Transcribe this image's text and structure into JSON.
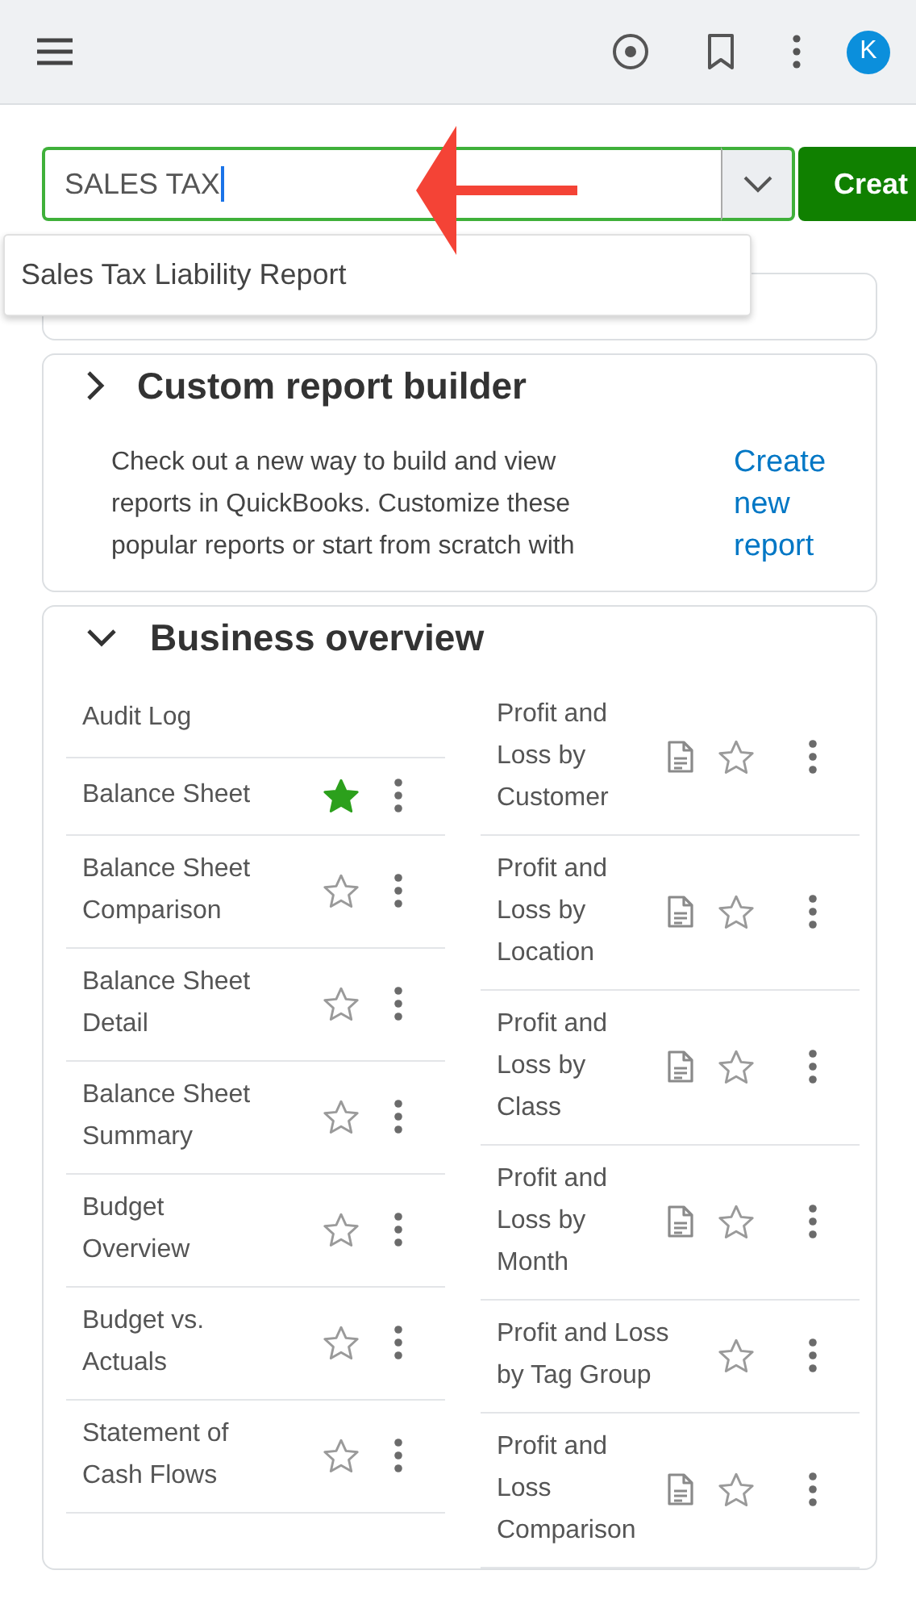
{
  "header": {
    "avatar_initial": "K"
  },
  "search": {
    "value": "SALES TAX",
    "focused": true
  },
  "create_button": "Creat",
  "suggestions": [
    "Sales Tax Liability Report"
  ],
  "custom_report_builder": {
    "title": "Custom report builder",
    "expanded": false,
    "description_lines": [
      "Check out a new way to build and view",
      "reports in QuickBooks. Customize these",
      "popular reports or start from scratch with"
    ],
    "link": "Create new report"
  },
  "business_overview": {
    "title": "Business overview",
    "expanded": true,
    "left_reports": [
      {
        "name": "Audit Log",
        "kind": "link"
      },
      {
        "name": "Balance Sheet",
        "kind": "report",
        "starred": true
      },
      {
        "name": "Balance Sheet Comparison",
        "kind": "report",
        "starred": false
      },
      {
        "name": "Balance Sheet Detail",
        "kind": "report",
        "starred": false
      },
      {
        "name": "Balance Sheet Summary",
        "kind": "report",
        "starred": false
      },
      {
        "name": "Budget Overview",
        "kind": "report",
        "starred": false
      },
      {
        "name": "Budget vs. Actuals",
        "kind": "report",
        "starred": false
      },
      {
        "name": "Statement of Cash Flows",
        "kind": "report",
        "starred": false
      }
    ],
    "right_reports": [
      {
        "name": "Profit and Loss by Customer",
        "kind": "report",
        "starred": false,
        "preview": true
      },
      {
        "name": "Profit and Loss by Location",
        "kind": "report",
        "starred": false,
        "preview": true
      },
      {
        "name": "Profit and Loss by Class",
        "kind": "report",
        "starred": false,
        "preview": true
      },
      {
        "name": "Profit and Loss by Month",
        "kind": "report",
        "starred": false,
        "preview": true
      },
      {
        "name": "Profit and Loss by Tag Group",
        "kind": "report",
        "starred": false,
        "preview": false
      },
      {
        "name": "Profit and Loss Comparison",
        "kind": "report",
        "starred": false,
        "preview": true
      }
    ]
  }
}
